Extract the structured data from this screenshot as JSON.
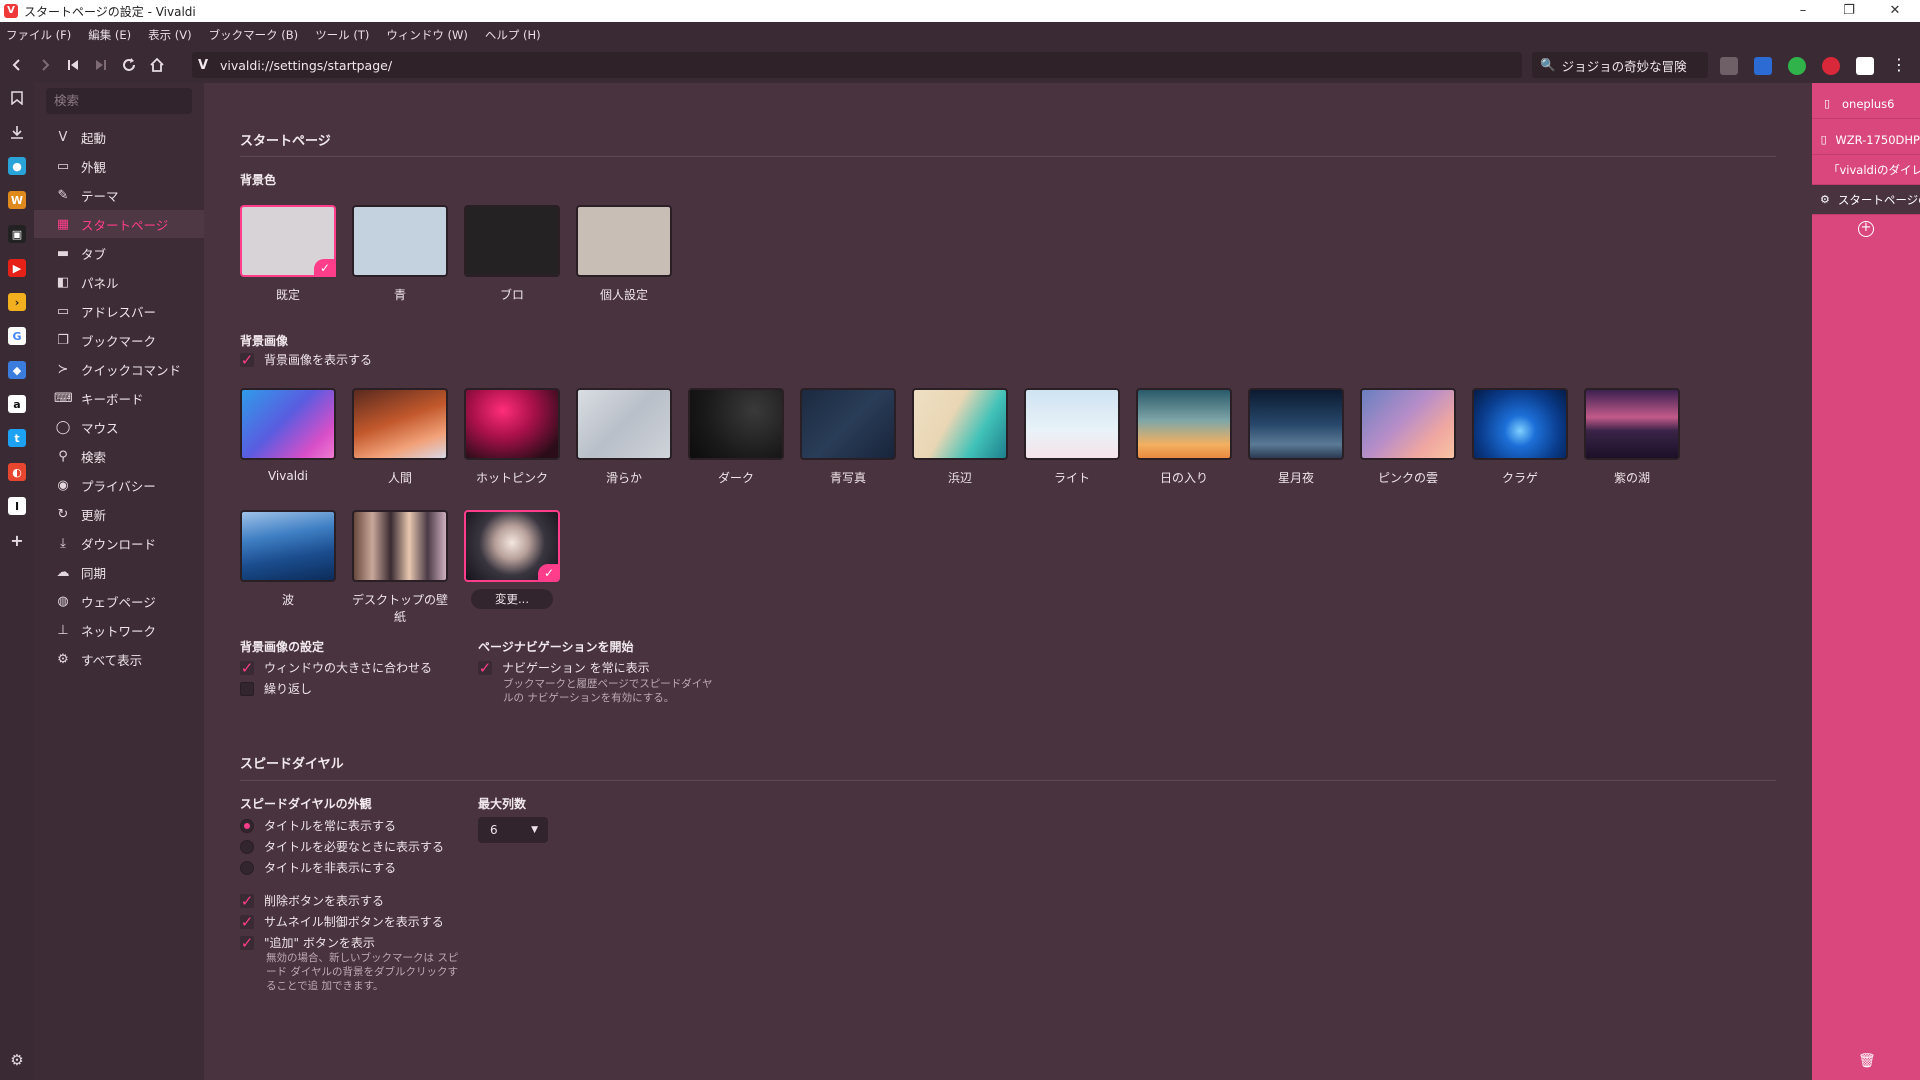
{
  "window": {
    "title": "スタートページの設定 - Vivaldi",
    "controls": {
      "minimize": "–",
      "restore": "❐",
      "close": "✕"
    }
  },
  "menu": [
    "ファイル (F)",
    "編集 (E)",
    "表示 (V)",
    "ブックマーク (B)",
    "ツール (T)",
    "ウィンドウ (W)",
    "ヘルプ (H)"
  ],
  "address": {
    "url": "vivaldi://settings/startpage/",
    "search_value": "ジョジョの奇妙な冒険"
  },
  "sidebar": {
    "search_placeholder": "検索",
    "items": [
      {
        "label": "起動",
        "icon": "vivaldi-icon"
      },
      {
        "label": "外観",
        "icon": "window-icon"
      },
      {
        "label": "テーマ",
        "icon": "brush-icon"
      },
      {
        "label": "スタートページ",
        "icon": "grid-icon"
      },
      {
        "label": "タブ",
        "icon": "tabs-icon"
      },
      {
        "label": "パネル",
        "icon": "panel-icon"
      },
      {
        "label": "アドレスバー",
        "icon": "addressbar-icon"
      },
      {
        "label": "ブックマーク",
        "icon": "bookmark-icon"
      },
      {
        "label": "クイックコマンド",
        "icon": "quick-command-icon"
      },
      {
        "label": "キーボード",
        "icon": "keyboard-icon"
      },
      {
        "label": "マウス",
        "icon": "mouse-icon"
      },
      {
        "label": "検索",
        "icon": "search-icon"
      },
      {
        "label": "プライバシー",
        "icon": "eye-icon"
      },
      {
        "label": "更新",
        "icon": "refresh-icon"
      },
      {
        "label": "ダウンロード",
        "icon": "download-icon"
      },
      {
        "label": "同期",
        "icon": "cloud-icon"
      },
      {
        "label": "ウェブページ",
        "icon": "globe-icon"
      },
      {
        "label": "ネットワーク",
        "icon": "network-icon"
      },
      {
        "label": "すべて表示",
        "icon": "gear-icon"
      }
    ],
    "active": "スタートページ"
  },
  "startpage": {
    "section_title": "スタートページ",
    "bg_color": {
      "heading": "背景色",
      "options": [
        {
          "label": "既定",
          "color": "#d8d3d6",
          "selected": true
        },
        {
          "label": "青",
          "color": "#c4d2e0",
          "selected": false
        },
        {
          "label": "ブロ",
          "color": "#252224",
          "selected": false
        },
        {
          "label": "個人設定",
          "color": "#c8beb6",
          "selected": false
        }
      ]
    },
    "bg_image": {
      "heading": "背景画像",
      "show_label": "背景画像を表示する",
      "show_checked": true,
      "images": [
        {
          "label": "Vivaldi"
        },
        {
          "label": "人間"
        },
        {
          "label": "ホットピンク"
        },
        {
          "label": "滑らか"
        },
        {
          "label": "ダーク"
        },
        {
          "label": "青写真"
        },
        {
          "label": "浜辺"
        },
        {
          "label": "ライト"
        },
        {
          "label": "日の入り"
        },
        {
          "label": "星月夜"
        },
        {
          "label": "ピンクの雲"
        },
        {
          "label": "クラゲ"
        },
        {
          "label": "紫の湖"
        },
        {
          "label": "波"
        },
        {
          "label": "デスクトップの壁紙"
        }
      ],
      "change_label": "変更..."
    },
    "bg_settings": {
      "heading": "背景画像の設定",
      "fit_label": "ウィンドウの大きさに合わせる",
      "fit_checked": true,
      "repeat_label": "繰り返し",
      "repeat_checked": false
    },
    "page_nav": {
      "heading": "ページナビゲーションを開始",
      "always_label": "ナビゲーション を常に表示",
      "always_checked": true,
      "note": "ブックマークと履歴ページでスピードダイヤルの ナビゲーションを有効にする。"
    }
  },
  "speeddial": {
    "section_title": "スピードダイヤル",
    "appearance_heading": "スピードダイヤルの外観",
    "title_options": [
      {
        "label": "タイトルを常に表示する",
        "selected": true
      },
      {
        "label": "タイトルを必要なときに表示する",
        "selected": false
      },
      {
        "label": "タイトルを非表示にする",
        "selected": false
      }
    ],
    "checks": [
      {
        "label": "削除ボタンを表示する",
        "checked": true
      },
      {
        "label": "サムネイル制御ボタンを表示する",
        "checked": true
      },
      {
        "label": "\"追加\" ボタンを表示",
        "checked": true
      }
    ],
    "add_note": "無効の場合、新しいブックマークは スピード ダイヤルの背景をダブルクリックすることで追 加できます。",
    "columns_heading": "最大列数",
    "columns_value": "6"
  },
  "right_panel": {
    "tabs": [
      {
        "label": "oneplus6",
        "icon": "page-icon"
      },
      {
        "label": "WZR-1750DHP",
        "icon": "page-icon"
      },
      {
        "label": "「vivaldiのダイレ",
        "icon": "green-app-icon"
      },
      {
        "label": "スタートページの設",
        "icon": "gear-icon"
      }
    ],
    "active_tab": 3
  },
  "colors": {
    "accent": "#ff3d8b",
    "panel": "#d9477d",
    "bg": "#49333f"
  }
}
